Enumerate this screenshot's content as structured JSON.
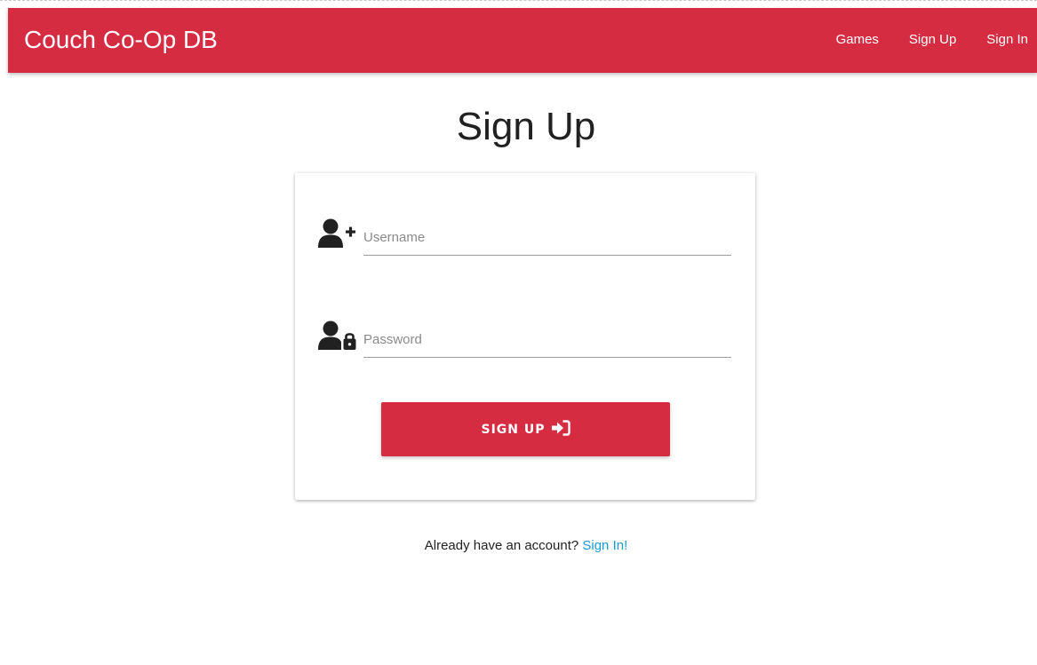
{
  "navbar": {
    "brand": "Couch Co-Op DB",
    "links": [
      {
        "label": "Games"
      },
      {
        "label": "Sign Up"
      },
      {
        "label": "Sign In"
      }
    ]
  },
  "page": {
    "title": "Sign Up"
  },
  "form": {
    "username": {
      "placeholder": "Username",
      "value": "",
      "icon": "user-plus-icon"
    },
    "password": {
      "placeholder": "Password",
      "value": "",
      "icon": "user-lock-icon"
    },
    "submit_label": "SIGN UP",
    "submit_icon": "sign-in-arrow-icon"
  },
  "footer": {
    "prompt": "Already have an account? ",
    "link_label": "Sign In!"
  },
  "colors": {
    "brand": "#d62c42",
    "link": "#1a9ad6",
    "icon": "#212121"
  }
}
